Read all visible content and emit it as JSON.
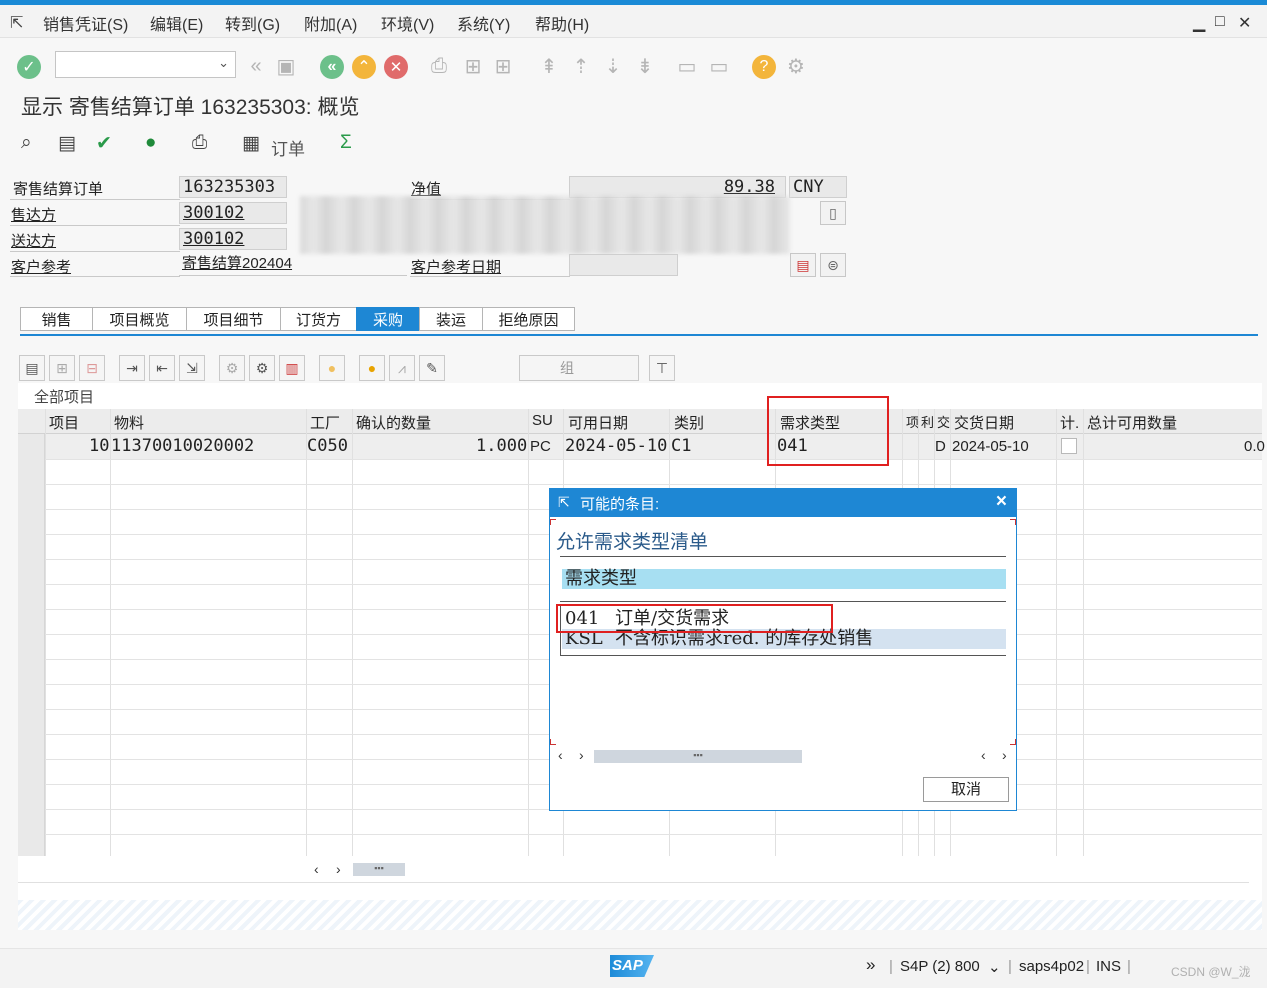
{
  "menu": {
    "items": [
      "销售凭证(S)",
      "编辑(E)",
      "转到(G)",
      "附加(A)",
      "环境(V)",
      "系统(Y)",
      "帮助(H)"
    ]
  },
  "title": "显示 寄售结算订单 163235303: 概览",
  "app_toolbar": {
    "order_label": "订单",
    "sum_symbol": "Σ"
  },
  "header": {
    "order_label": "寄售结算订单",
    "order_value": "163235303",
    "netvalue_label": "净值",
    "netvalue_value": "89.38",
    "currency": "CNY",
    "soldto_label": "售达方",
    "soldto_value": "300102",
    "shipto_label": "送达方",
    "shipto_value": "300102",
    "custref_label": "客户参考",
    "custref_value": "寄售结算202404",
    "custrefdate_label": "客户参考日期"
  },
  "tabs": [
    "销售",
    "项目概览",
    "项目细节",
    "订货方",
    "采购",
    "装运",
    "拒绝原因"
  ],
  "active_tab": "采购",
  "grid": {
    "group_button": "组",
    "caption": "全部项目",
    "headers": [
      "项目",
      "物料",
      "工厂",
      "确认的数量",
      "SU",
      "可用日期",
      "类别",
      "需求类型",
      "项",
      "利",
      "交",
      "交货日期",
      "计.",
      "总计可用数量"
    ],
    "row": {
      "item": "10",
      "material": "11370010020002",
      "plant": "C050",
      "qty": "1.000",
      "su": "PC",
      "avail_date": "2024-05-10",
      "category": "C1",
      "req_type": "041",
      "d_flag": "D",
      "delivery_date": "2024-05-10",
      "total_qty": "0.0"
    }
  },
  "popup": {
    "title": "可能的条目:",
    "subtitle": "允许需求类型清单",
    "column_header": "需求类型",
    "rows": [
      {
        "code": "041",
        "desc": "订单/交货需求"
      },
      {
        "code": "KSL",
        "desc": "不含标识需求red. 的库存处销售"
      }
    ],
    "cancel_label": "取消"
  },
  "status": {
    "system": "S4P (2) 800",
    "server": "saps4p02",
    "mode": "INS",
    "watermark": "CSDN @W_泷"
  },
  "colors": {
    "accent": "#1e87d4",
    "highlight_box": "#e02020"
  }
}
